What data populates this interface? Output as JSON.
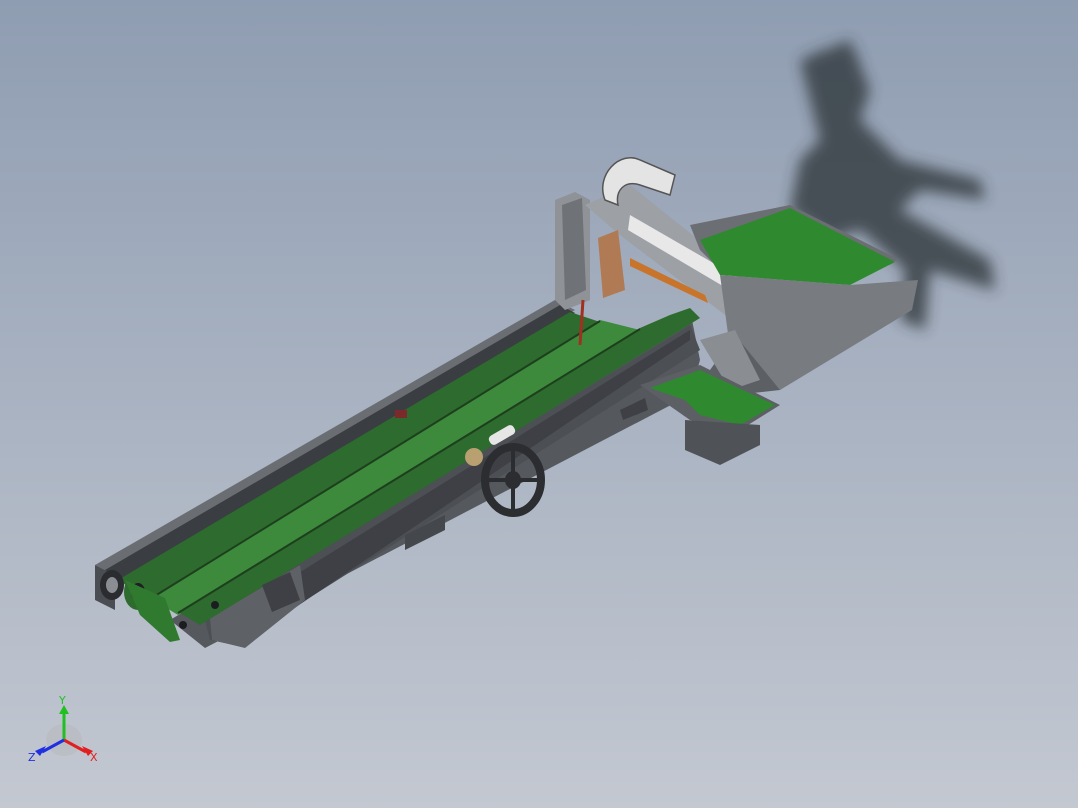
{
  "scene": {
    "background_top": "#8f9db2",
    "background_bottom": "#c3c8d1",
    "colors": {
      "belt": "#2e6b2e",
      "belt_light": "#3d8a3d",
      "tray": "#2f8a2f",
      "frame": "#5a5d62",
      "frame_dark": "#3a3c40",
      "frame_light": "#8a8d92",
      "accent_orange": "#c8742a",
      "accent_copper": "#b07a55"
    }
  },
  "triad": {
    "y_label": "Y",
    "x_label": "X",
    "z_label": "Z",
    "x_color": "#e02020",
    "y_color": "#20c020",
    "z_color": "#2030e0"
  }
}
